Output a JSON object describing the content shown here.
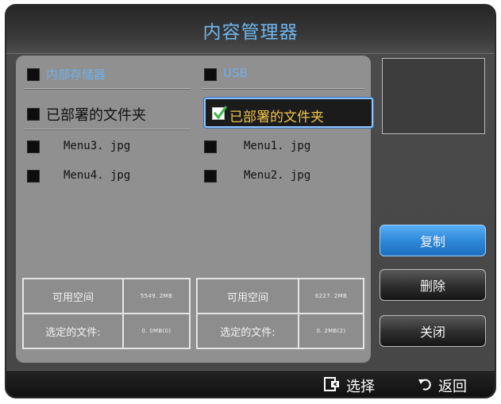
{
  "window": {
    "title": "内容管理器"
  },
  "sources": {
    "internal_label": "内部存储器",
    "usb_label": "USB"
  },
  "internal": {
    "folder_label": "已部署的文件夹",
    "files": [
      "Menu3. jpg",
      "Menu4. jpg"
    ],
    "info": {
      "free_space_label": "可用空间",
      "free_space_value": "5549. 2MB",
      "selected_label": "选定的文件:",
      "selected_value": "0. 0MB(0)"
    }
  },
  "usb": {
    "folder_label": "已部署的文件夹",
    "files": [
      "Menu1. jpg",
      "Menu2. jpg"
    ],
    "info": {
      "free_space_label": "可用空间",
      "free_space_value": "6227. 2MB",
      "selected_label": "选定的文件:",
      "selected_value": "0. 2MB(2)"
    }
  },
  "buttons": {
    "copy": "复制",
    "delete": "删除",
    "close": "关闭"
  },
  "footer": {
    "select_label": "选择",
    "back_label": "返回"
  },
  "colors": {
    "accent_blue": "#6fb7ec",
    "selected_text": "#f0c34a",
    "check_green": "#3bb54a"
  }
}
